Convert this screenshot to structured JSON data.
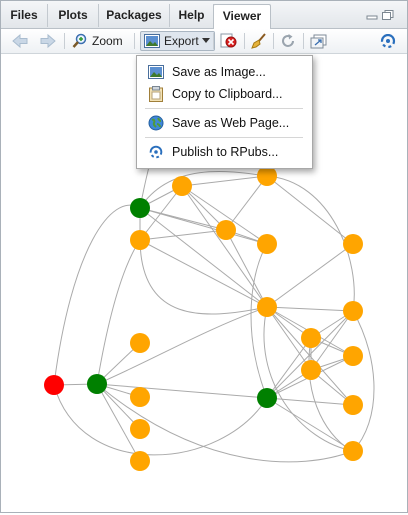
{
  "tabs": [
    {
      "label": "Files"
    },
    {
      "label": "Plots"
    },
    {
      "label": "Packages"
    },
    {
      "label": "Help"
    },
    {
      "label": "Viewer"
    }
  ],
  "toolbar": {
    "zoom_label": "Zoom",
    "export_label": "Export"
  },
  "export_menu": {
    "items": [
      {
        "label": "Save as Image...",
        "icon": "image-icon"
      },
      {
        "label": "Copy to Clipboard...",
        "icon": "clipboard-icon"
      },
      {
        "label": "Save as Web Page...",
        "icon": "globe-icon"
      },
      {
        "label": "Publish to RPubs...",
        "icon": "rpubs-icon"
      }
    ]
  },
  "graph": {
    "node_colors": {
      "red": "#ff0000",
      "green": "#008000",
      "orange": "#ffa500"
    },
    "edge_color": "#aaaaaa"
  },
  "colors": {
    "accent": "#2a6fbd",
    "active_tab_bg": "#ffffff"
  }
}
